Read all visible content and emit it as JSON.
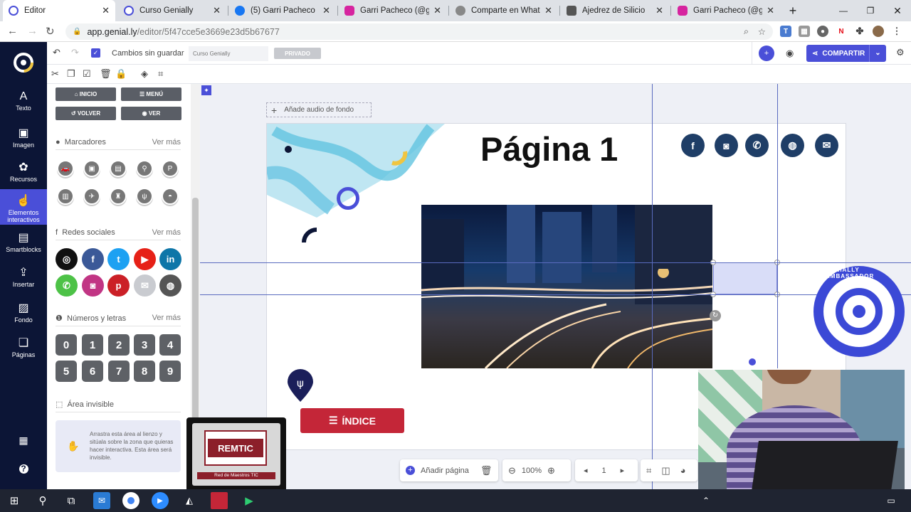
{
  "browser": {
    "tabs": [
      {
        "label": "Editor",
        "color": "#4a4fd8"
      },
      {
        "label": "Curso Genially",
        "color": "#4a4fd8"
      },
      {
        "label": "(5) Garri Pacheco | Face",
        "color": "#1877f2"
      },
      {
        "label": "Garri Pacheco (@garrip",
        "color": "#d6249f"
      },
      {
        "label": "Comparte en WhatsApp",
        "color": "#666666"
      },
      {
        "label": "Ajedrez de Silicio",
        "color": "#444444"
      },
      {
        "label": "Garri Pacheco (@garrip",
        "color": "#d6249f"
      }
    ],
    "url_host": "app.genial.ly",
    "url_path": "/editor/5f47cce5e3669e23d5b67677",
    "new_tab": "+"
  },
  "rail": {
    "items": [
      {
        "label": "Texto",
        "icon": "A"
      },
      {
        "label": "Imagen",
        "icon": "▣"
      },
      {
        "label": "Recursos",
        "icon": "✿"
      },
      {
        "label": "Elementos interactivos",
        "icon": "☝"
      },
      {
        "label": "Smartblocks",
        "icon": "▤"
      },
      {
        "label": "Insertar",
        "icon": "⇪"
      },
      {
        "label": "Fondo",
        "icon": "▨"
      },
      {
        "label": "Páginas",
        "icon": "❏"
      }
    ]
  },
  "toolbar": {
    "status": "Cambios sin guardar",
    "title_placeholder": "Curso Genially",
    "privacy": "PRIVADO",
    "share": "COMPARTIR"
  },
  "panel": {
    "buttons": [
      "INICIO",
      "MENÚ",
      "VOLVER",
      "VER"
    ],
    "sections": {
      "markers": "Marcadores",
      "social": "Redes sociales",
      "numbers": "Números y letras",
      "invisible": "Área invisible",
      "more": "Ver más"
    },
    "numbers": [
      "0",
      "1",
      "2",
      "3",
      "4",
      "5",
      "6",
      "7",
      "8",
      "9"
    ],
    "invisible_help": "Arrastra esta área al lienzo y sitúala sobre la zona que quieras hacer interactiva. Esta área será invisible."
  },
  "canvas": {
    "audio": "Añade audio de fondo",
    "page_title": "Página 1",
    "index_button": "ÍNDICE",
    "badge": "GENIALLY AMBASSADOR",
    "remtic": "REMTIC",
    "remtic_sub": "Red de Maestros TIC"
  },
  "bottom": {
    "add_page": "Añadir página",
    "zoom": "100%",
    "page": "1"
  },
  "colors": {
    "brand": "#4a4fd8",
    "rail": "#0c1536",
    "index_red": "#c42638",
    "social_dark": "#1f3e67"
  }
}
